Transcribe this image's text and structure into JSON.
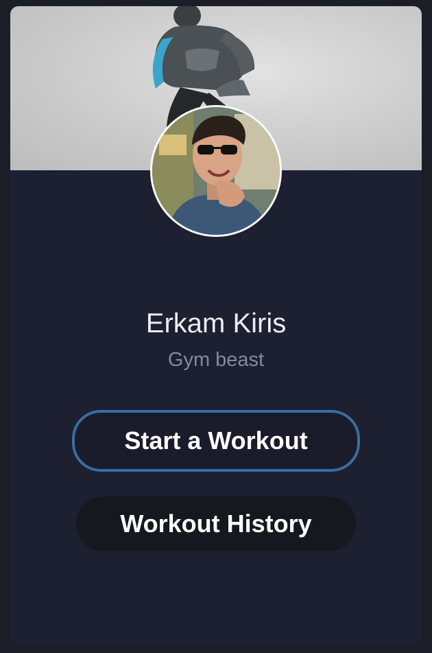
{
  "profile": {
    "name": "Erkam Kiris",
    "tagline": "Gym beast"
  },
  "actions": {
    "start_workout_label": "Start a Workout",
    "workout_history_label": "Workout History"
  },
  "colors": {
    "page_background": "#1b1e27",
    "card_background": "#1d2030",
    "primary_button_border": "#3a6d9f",
    "name_text": "#eceef3",
    "tagline_text": "#7f8aa4"
  },
  "images": {
    "cover": "cover-photo-fitness-model",
    "avatar": "profile-photo"
  }
}
